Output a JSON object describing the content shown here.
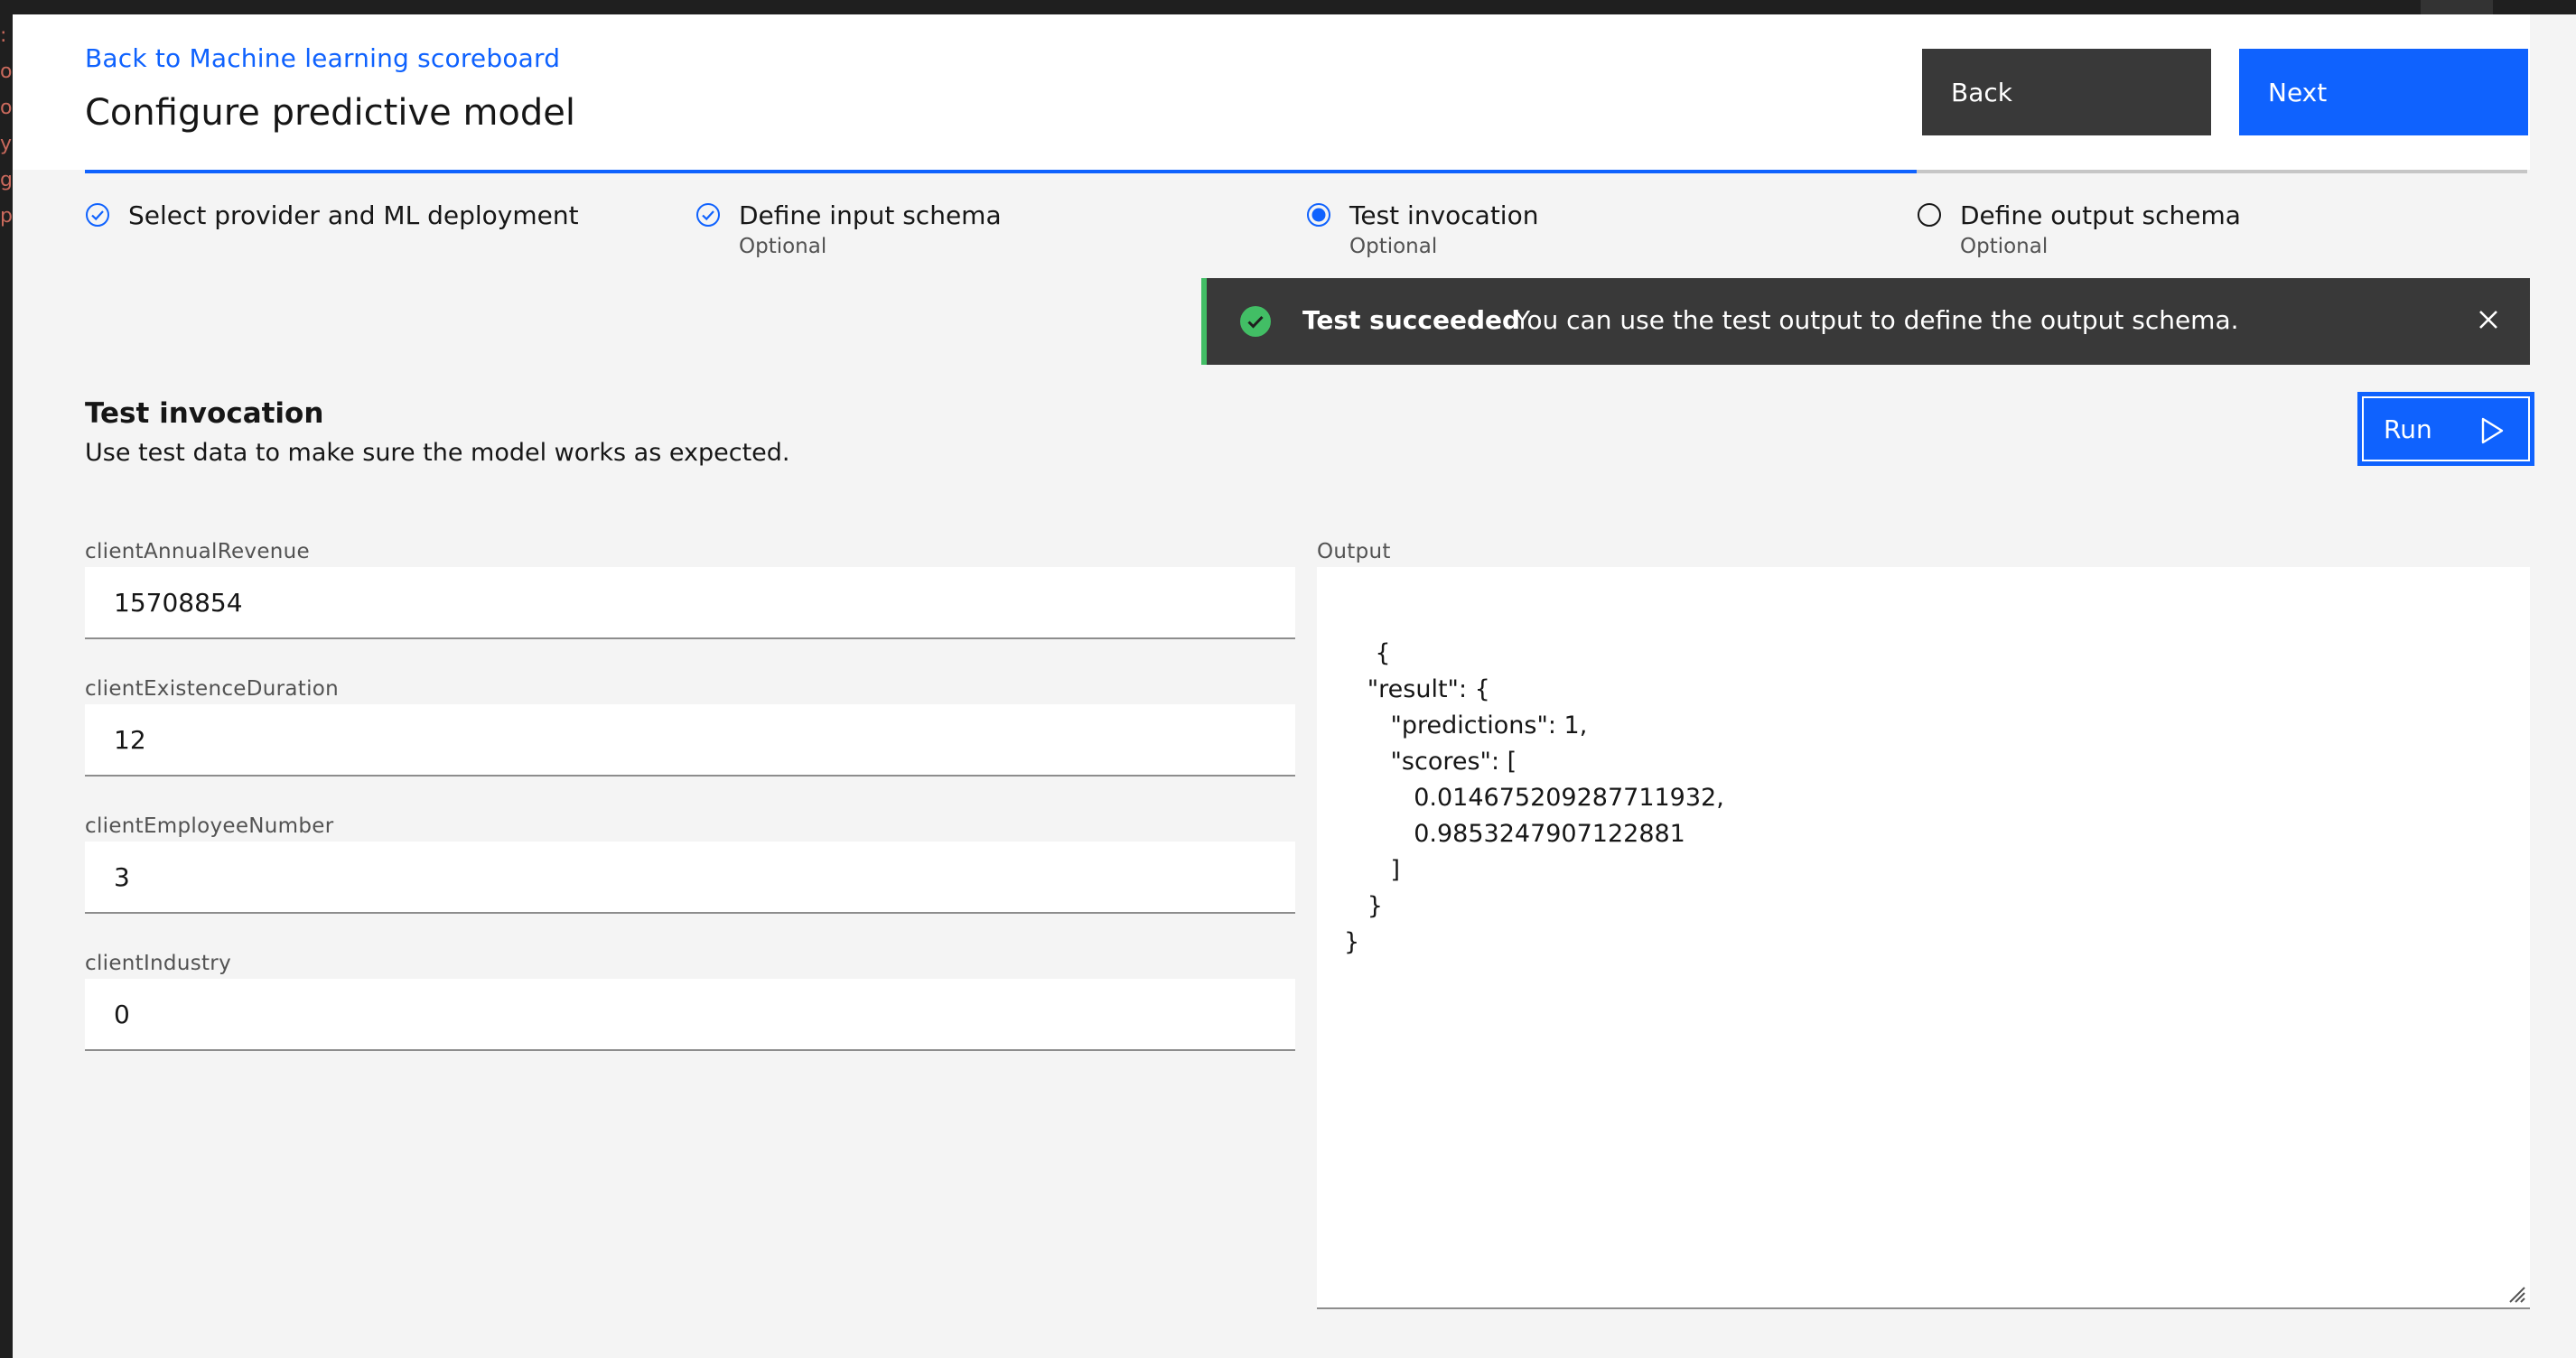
{
  "header": {
    "back_link": "Back to Machine learning scoreboard",
    "title": "Configure predictive model",
    "back_button": "Back",
    "next_button": "Next"
  },
  "progress": {
    "steps": [
      {
        "label": "Select provider and ML deployment",
        "sub": "",
        "state": "complete"
      },
      {
        "label": "Define input schema",
        "sub": "Optional",
        "state": "complete"
      },
      {
        "label": "Test invocation",
        "sub": "Optional",
        "state": "current"
      },
      {
        "label": "Define output schema",
        "sub": "Optional",
        "state": "incomplete"
      }
    ]
  },
  "notification": {
    "title": "Test succeeded",
    "message": "You can use the test output to define the output schema.",
    "kind": "success",
    "icon": "checkmark-filled-icon"
  },
  "section": {
    "title": "Test invocation",
    "description": "Use test data to make sure the model works as expected.",
    "run_button": "Run"
  },
  "fields": [
    {
      "label": "clientAnnualRevenue",
      "value": "15708854"
    },
    {
      "label": "clientExistenceDuration",
      "value": "12"
    },
    {
      "label": "clientEmployeeNumber",
      "value": "3"
    },
    {
      "label": "clientIndustry",
      "value": "0"
    }
  ],
  "output": {
    "label": "Output",
    "text": "{\n   \"result\": {\n      \"predictions\": 1,\n      \"scores\": [\n         0.014675209287711932,\n         0.9853247907122881\n      ]\n   }\n}"
  },
  "colors": {
    "primary": "#0f62fe",
    "secondary": "#393939",
    "success": "#42be65",
    "background": "#f4f4f4"
  }
}
